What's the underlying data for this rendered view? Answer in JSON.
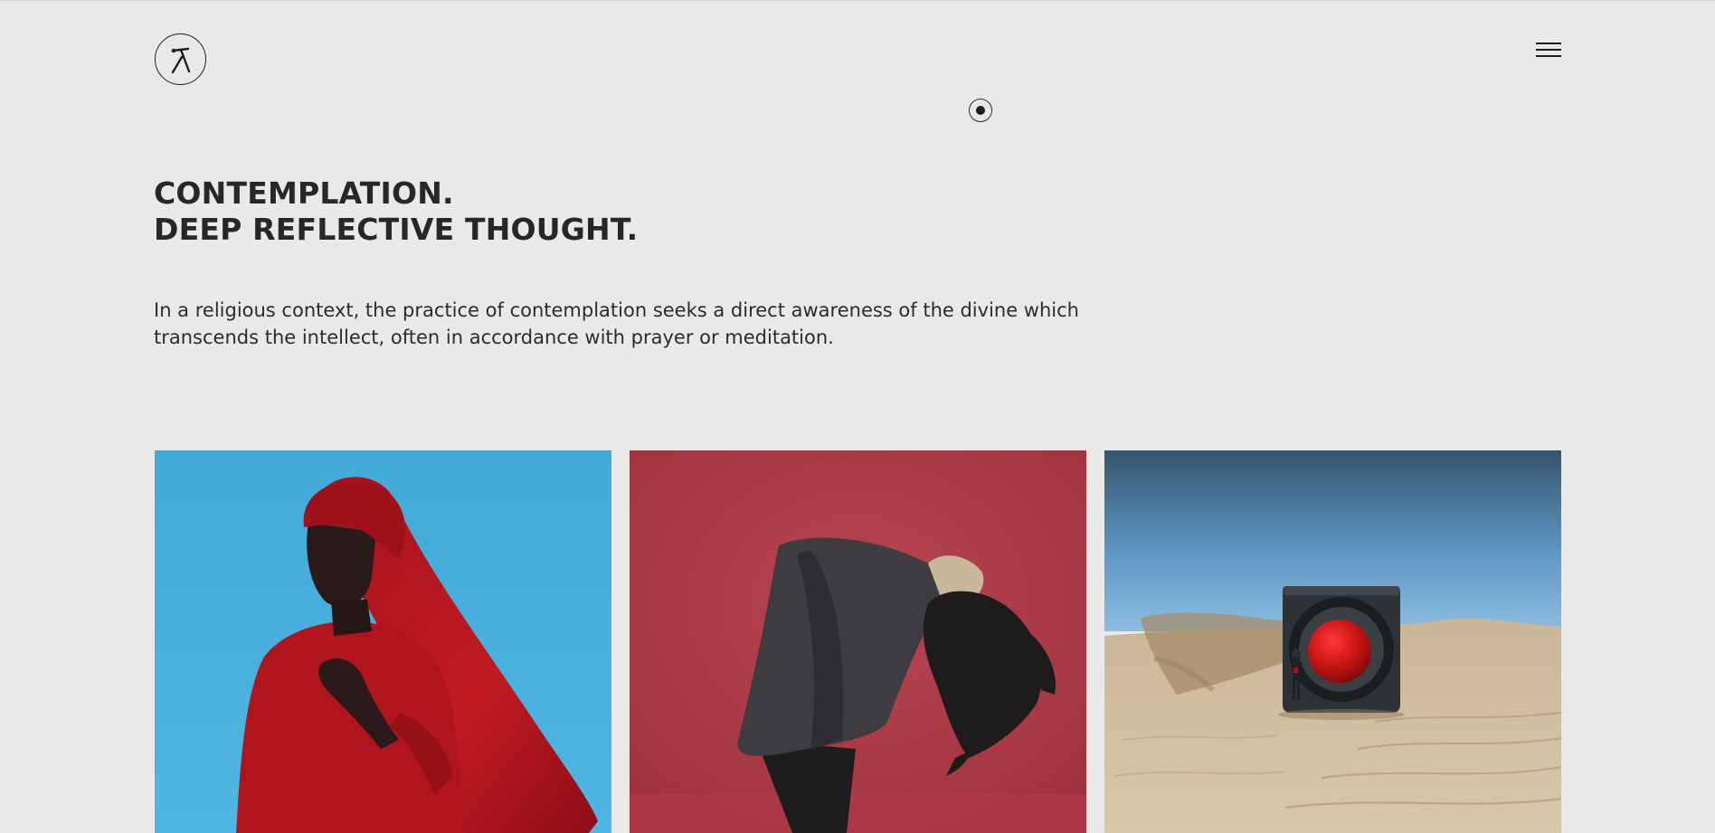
{
  "header": {
    "logo_icon": "runner-icon",
    "menu_icon": "hamburger-menu-icon",
    "cursor_icon": "cursor-dot-icon"
  },
  "hero": {
    "title_line1": "CONTEMPLATION.",
    "title_line2": "DEEP REFLECTIVE THOUGHT.",
    "description": "In a religious context, the practice of contemplation seeks a direct awareness of the divine which transcends the intellect, often in accordance with prayer or meditation."
  },
  "gallery": {
    "items": [
      {
        "name": "red-veiled-figure-image",
        "background": "#4ab0dc",
        "accent": "#b3141e"
      },
      {
        "name": "bowing-figure-image",
        "background": "#b23d48",
        "accent": "#3d3b3e"
      },
      {
        "name": "desert-speaker-image",
        "background": "#4a7ea8",
        "accent": "#cc1717"
      }
    ]
  },
  "colors": {
    "page_background": "#ebe9e7",
    "text": "#26272b"
  }
}
